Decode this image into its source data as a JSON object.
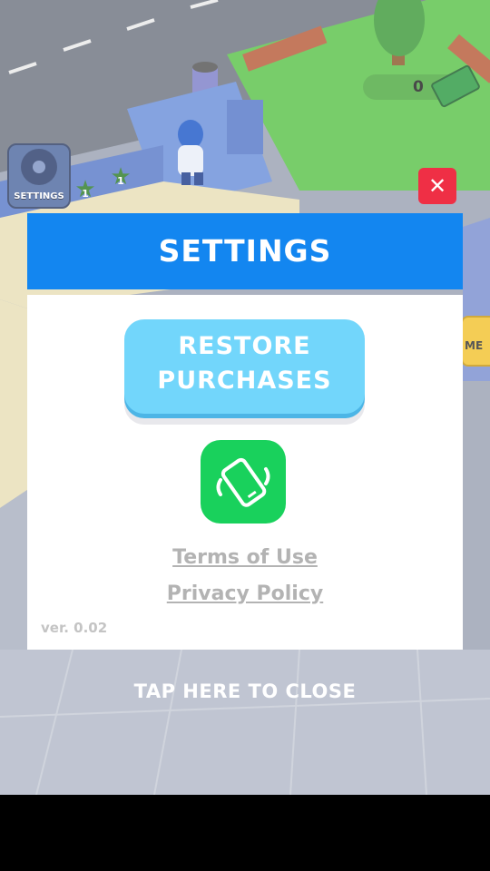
{
  "hud": {
    "settings_label": "SETTINGS",
    "star_levels": [
      "1",
      "1"
    ],
    "money_value": "0",
    "side_button_label": "ME"
  },
  "settings_modal": {
    "title": "SETTINGS",
    "restore_line1": "RESTORE",
    "restore_line2": "PURCHASES",
    "vibration_icon": "phone-vibrate-icon",
    "terms_label": "Terms of Use",
    "privacy_label": "Privacy Policy",
    "version": "ver. 0.02",
    "close_icon": "close-icon",
    "tap_to_close": "TAP HERE TO CLOSE"
  },
  "colors": {
    "header_blue": "#1386f0",
    "restore_blue": "#72d6fb",
    "vibration_green": "#19d15c",
    "close_red": "#ef2f45"
  }
}
